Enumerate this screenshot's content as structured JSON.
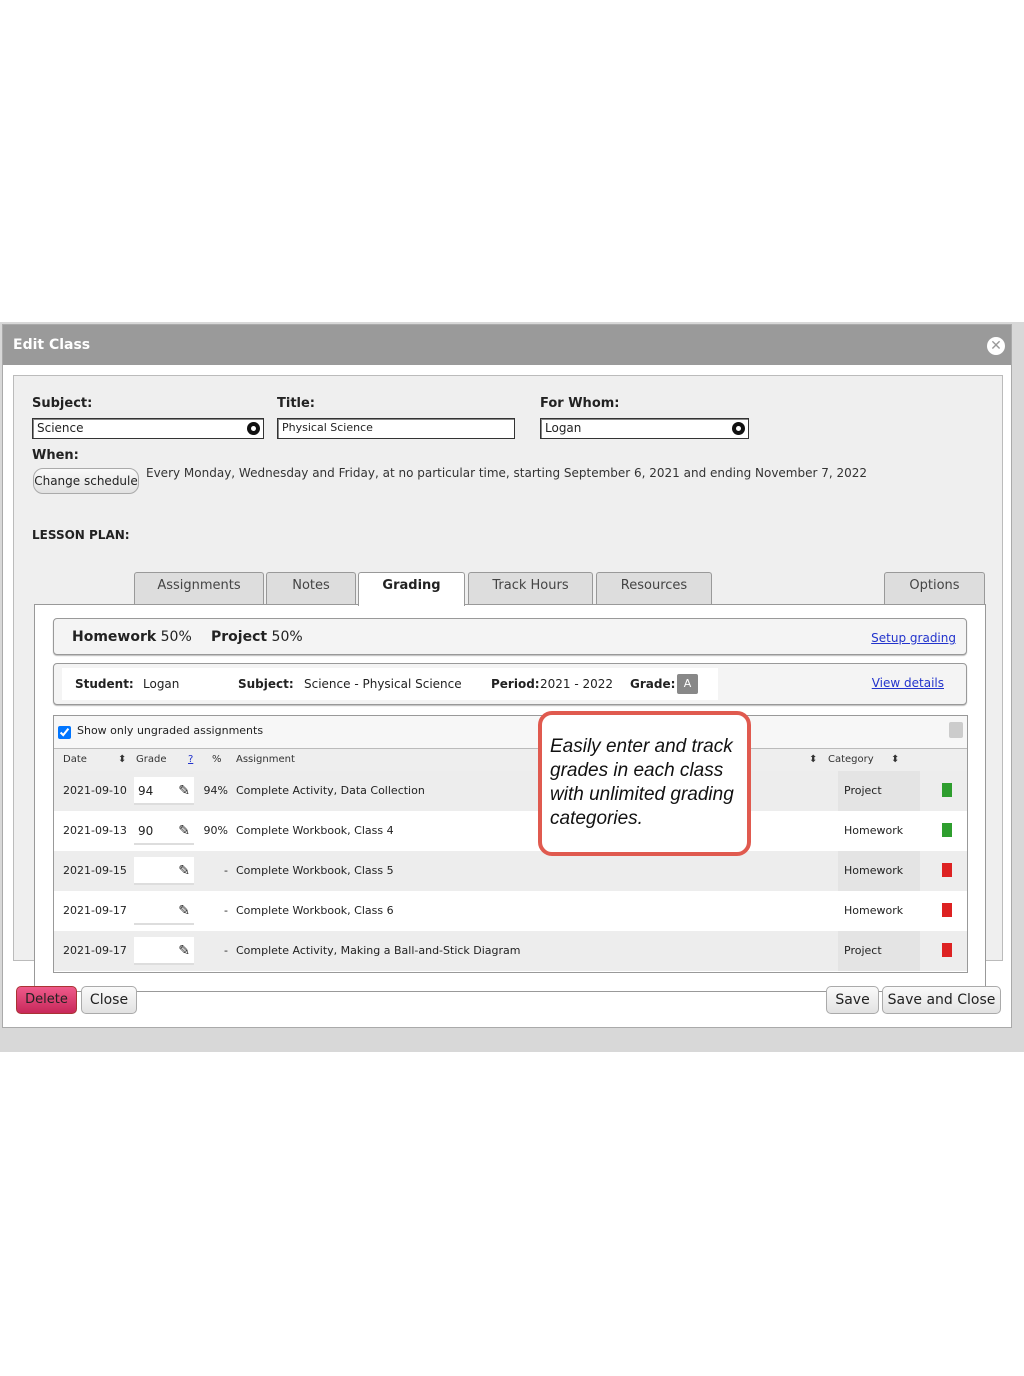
{
  "dialog": {
    "title": "Edit Class",
    "close_icon": "close-circle-icon"
  },
  "form": {
    "subject_label": "Subject:",
    "subject_value": "Science",
    "title_label": "Title:",
    "title_value": "Physical Science",
    "for_whom_label": "For Whom:",
    "for_whom_value": "Logan",
    "when_label": "When:",
    "change_schedule": "Change schedule",
    "schedule_text": "Every Monday, Wednesday and Friday, at no particular time, starting September 6, 2021 and ending November 7, 2022"
  },
  "lesson_plan": {
    "label": "LESSON PLAN:",
    "tabs": [
      {
        "label": "Assignments"
      },
      {
        "label": "Notes"
      },
      {
        "label": "Grading",
        "active": true
      },
      {
        "label": "Track Hours"
      },
      {
        "label": "Resources"
      }
    ],
    "options": "Options"
  },
  "grading": {
    "cat1_name": "Homework",
    "cat1_pct": "50%",
    "cat2_name": "Project",
    "cat2_pct": "50%",
    "setup_link": "Setup grading"
  },
  "student": {
    "student_label": "Student:",
    "student_value": "Logan",
    "subject_label": "Subject:",
    "subject_value": "Science - Physical Science",
    "period_label": "Period:",
    "period_value": "2021 - 2022",
    "grade_label": "Grade:",
    "grade_value": "A",
    "view_details": "View details"
  },
  "table": {
    "filter_label": "Show only ungraded assignments",
    "filter_checked": true,
    "headers": {
      "date": "Date",
      "grade": "Grade",
      "help": "?",
      "pct": "%",
      "assignment": "Assignment",
      "category": "Category"
    },
    "rows": [
      {
        "date": "2021-09-10",
        "grade": "94",
        "pct": "94%",
        "assignment": "Complete Activity, Data Collection",
        "category": "Project",
        "flag": "#2e9e2e"
      },
      {
        "date": "2021-09-13",
        "grade": "90",
        "pct": "90%",
        "assignment": "Complete Workbook, Class 4",
        "category": "Homework",
        "flag": "#2e9e2e"
      },
      {
        "date": "2021-09-15",
        "grade": "",
        "pct": "-",
        "assignment": "Complete Workbook, Class 5",
        "category": "Homework",
        "flag": "#dd2222"
      },
      {
        "date": "2021-09-17",
        "grade": "",
        "pct": "-",
        "assignment": "Complete Workbook, Class 6",
        "category": "Homework",
        "flag": "#dd2222"
      },
      {
        "date": "2021-09-17",
        "grade": "",
        "pct": "-",
        "assignment": "Complete Activity, Making a Ball-and-Stick Diagram",
        "category": "Project",
        "flag": "#dd2222"
      }
    ]
  },
  "callout": "Easily enter and track grades in each class with unlimited grading categories.",
  "footer": {
    "delete": "Delete",
    "close": "Close",
    "save": "Save",
    "save_close": "Save and Close"
  }
}
